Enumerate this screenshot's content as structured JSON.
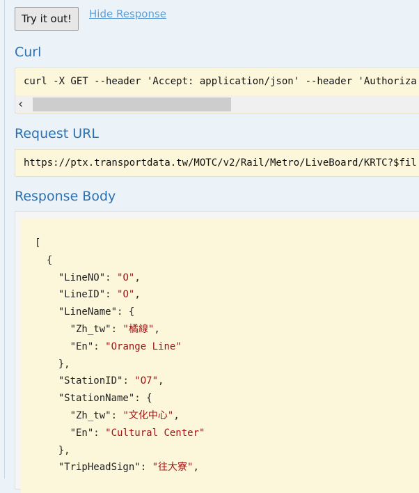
{
  "actions": {
    "try_label": "Try it out!",
    "hide_label": "Hide Response"
  },
  "curl": {
    "heading": "Curl",
    "command": "curl -X GET --header 'Accept: application/json' --header 'Authoriza"
  },
  "request_url": {
    "heading": "Request URL",
    "url": "https://ptx.transportdata.tw/MOTC/v2/Rail/Metro/LiveBoard/KRTC?$fil"
  },
  "response_body": {
    "heading": "Response Body",
    "lines": [
      {
        "indent": "",
        "parts": [
          {
            "t": "p",
            "v": "["
          }
        ]
      },
      {
        "indent": "  ",
        "parts": [
          {
            "t": "p",
            "v": "{"
          }
        ]
      },
      {
        "indent": "    ",
        "parts": [
          {
            "t": "k",
            "v": "\"LineNO\""
          },
          {
            "t": "p",
            "v": ": "
          },
          {
            "t": "s",
            "v": "\"O\""
          },
          {
            "t": "p",
            "v": ","
          }
        ]
      },
      {
        "indent": "    ",
        "parts": [
          {
            "t": "k",
            "v": "\"LineID\""
          },
          {
            "t": "p",
            "v": ": "
          },
          {
            "t": "s",
            "v": "\"O\""
          },
          {
            "t": "p",
            "v": ","
          }
        ]
      },
      {
        "indent": "    ",
        "parts": [
          {
            "t": "k",
            "v": "\"LineName\""
          },
          {
            "t": "p",
            "v": ": {"
          }
        ]
      },
      {
        "indent": "      ",
        "parts": [
          {
            "t": "k",
            "v": "\"Zh_tw\""
          },
          {
            "t": "p",
            "v": ": "
          },
          {
            "t": "s",
            "v": "\"橘線\""
          },
          {
            "t": "p",
            "v": ","
          }
        ]
      },
      {
        "indent": "      ",
        "parts": [
          {
            "t": "k",
            "v": "\"En\""
          },
          {
            "t": "p",
            "v": ": "
          },
          {
            "t": "s",
            "v": "\"Orange Line\""
          }
        ]
      },
      {
        "indent": "    ",
        "parts": [
          {
            "t": "p",
            "v": "},"
          }
        ]
      },
      {
        "indent": "    ",
        "parts": [
          {
            "t": "k",
            "v": "\"StationID\""
          },
          {
            "t": "p",
            "v": ": "
          },
          {
            "t": "s",
            "v": "\"O7\""
          },
          {
            "t": "p",
            "v": ","
          }
        ]
      },
      {
        "indent": "    ",
        "parts": [
          {
            "t": "k",
            "v": "\"StationName\""
          },
          {
            "t": "p",
            "v": ": {"
          }
        ]
      },
      {
        "indent": "      ",
        "parts": [
          {
            "t": "k",
            "v": "\"Zh_tw\""
          },
          {
            "t": "p",
            "v": ": "
          },
          {
            "t": "s",
            "v": "\"文化中心\""
          },
          {
            "t": "p",
            "v": ","
          }
        ]
      },
      {
        "indent": "      ",
        "parts": [
          {
            "t": "k",
            "v": "\"En\""
          },
          {
            "t": "p",
            "v": ": "
          },
          {
            "t": "s",
            "v": "\"Cultural Center\""
          }
        ]
      },
      {
        "indent": "    ",
        "parts": [
          {
            "t": "p",
            "v": "},"
          }
        ]
      },
      {
        "indent": "    ",
        "parts": [
          {
            "t": "k",
            "v": "\"TripHeadSign\""
          },
          {
            "t": "p",
            "v": ": "
          },
          {
            "t": "s",
            "v": "\"往大寮\""
          },
          {
            "t": "p",
            "v": ","
          }
        ]
      }
    ]
  },
  "colors": {
    "heading": "#2d70b0",
    "link": "#5e9fd8",
    "json_string": "#a31515",
    "code_bg": "#fcf6db",
    "page_bg": "#ebf3f9"
  },
  "icons": {
    "scroll_left": "chevron-left-icon"
  }
}
